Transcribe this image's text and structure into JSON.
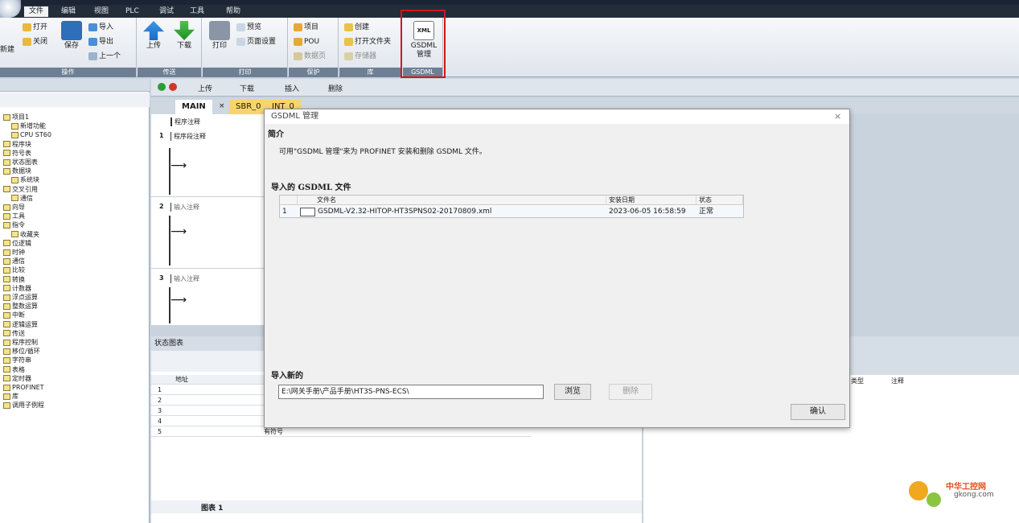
{
  "menu": {
    "items": [
      "文件",
      "编辑",
      "视图",
      "PLC",
      "调试",
      "工具",
      "帮助"
    ],
    "active_index": 0
  },
  "ribbon": {
    "groups": [
      {
        "label": "操作",
        "buttons": [
          "打开",
          "关闭",
          "新建",
          "保存",
          "导入",
          "导出",
          "上一个"
        ]
      },
      {
        "label": "传送",
        "buttons": [
          "上传",
          "下载"
        ]
      },
      {
        "label": "打印",
        "buttons": [
          "打印",
          "预览",
          "页面设置"
        ]
      },
      {
        "label": "保护",
        "buttons": [
          "项目",
          "POU",
          "数据页"
        ]
      },
      {
        "label": "库",
        "buttons": [
          "创建",
          "打开文件夹",
          "存储器"
        ]
      },
      {
        "label": "GSDML",
        "buttons": [
          "GSDML",
          "管理"
        ]
      }
    ]
  },
  "project_tree": {
    "items": [
      "项目1",
      "新增功能",
      "CPU ST60",
      "程序块",
      "符号表",
      "状态图表",
      "数据块",
      "系统块",
      "交叉引用",
      "通信",
      "向导",
      "工具",
      "指令",
      "收藏夹",
      "位逻辑",
      "时钟",
      "通信",
      "比较",
      "转换",
      "计数器",
      "浮点运算",
      "整数运算",
      "中断",
      "逻辑运算",
      "传送",
      "程序控制",
      "移位/循环",
      "字符串",
      "表格",
      "定时器",
      "PROFINET",
      "库",
      "调用子例程"
    ]
  },
  "toolbar2": {
    "upload": "上传",
    "download": "下载",
    "insert": "插入",
    "delete": "删除"
  },
  "editor": {
    "tabs": [
      "MAIN",
      "SBR_0",
      "INT_0"
    ],
    "program_comment": "程序注释",
    "networks": [
      {
        "num": "1",
        "comment": "程序段注释"
      },
      {
        "num": "2",
        "comment": "输入注释"
      },
      {
        "num": "3",
        "comment": "输入注释"
      }
    ]
  },
  "status_chart": {
    "title": "状态图表",
    "address_header": "地址",
    "rows": [
      "1",
      "2",
      "3",
      "4",
      "5"
    ],
    "format_value": "有符号",
    "sheet_tab": "图表 1"
  },
  "right_panel": {
    "type_header": "类型",
    "comment_header": "注释"
  },
  "dialog": {
    "title": "GSDML 管理",
    "intro_heading": "简介",
    "intro_text": "可用\"GSDML 管理\"来为 PROFINET 安装和删除 GSDML 文件。",
    "imported_heading": "导入的 GSDML 文件",
    "table_headers": [
      "文件名",
      "安装日期",
      "状态"
    ],
    "table_rows": [
      {
        "index": "1",
        "filename": "GSDML-V2.32-HITOP-HT3SPNS02-20170809.xml",
        "date": "2023-06-05 16:58:59",
        "status": "正常"
      }
    ],
    "import_new_heading": "导入新的",
    "path_value": "E:\\网关手册\\产品手册\\HT3S-PNS-ECS\\",
    "browse_label": "浏览",
    "delete_label": "删除",
    "ok_label": "确认"
  },
  "watermark": {
    "line1": "中华工控网",
    "line2": "gkong.com"
  }
}
